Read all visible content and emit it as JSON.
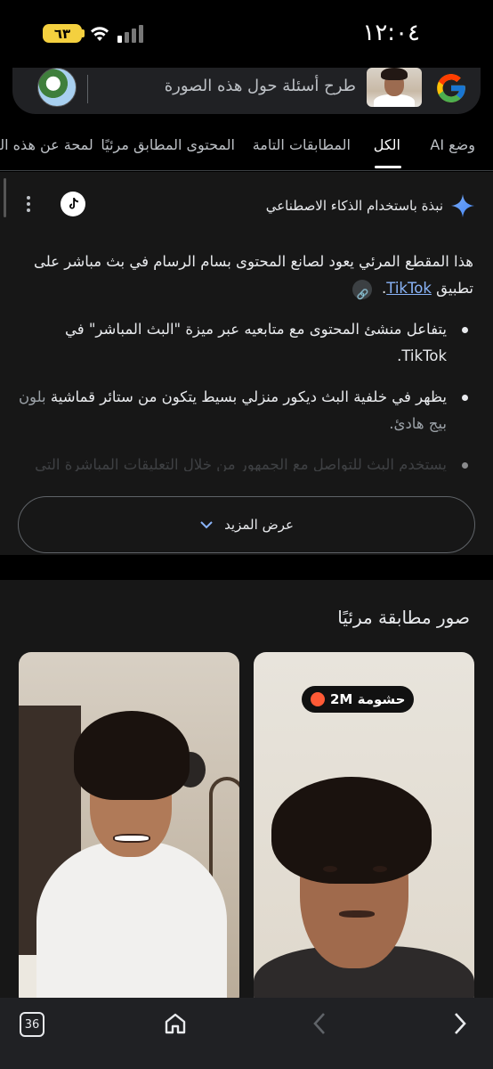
{
  "status_bar": {
    "time": "١٢:٠٤",
    "battery": "٦٣"
  },
  "search": {
    "placeholder": "طرح أسئلة حول هذه الصورة"
  },
  "tabs": [
    {
      "label": "وضع AI"
    },
    {
      "label": "الكل"
    },
    {
      "label": "المطابقات التامة"
    },
    {
      "label": "المحتوى المطابق مرئيًا"
    },
    {
      "label": "لمحة عن هذه الصورة"
    }
  ],
  "ai_overview": {
    "title": "نبذة باستخدام الذكاء الاصطناعي",
    "intro": "هذا المقطع المرئي يعود لصانع المحتوى بسام الرسام في بث مباشر على تطبيق",
    "intro_link": "TikTok",
    "intro_end": ".",
    "bullet_1": "يتفاعل منشئ المحتوى مع متابعيه عبر ميزة \"البث المباشر\" في TikTok.",
    "bullet_2_main": "يظهر في خلفية البث ديكور منزلي بسيط يتكون من ستائر قماشية",
    "bullet_2_faded": "بلون بيج هادئ.",
    "bullet_3_faded": "يستخدم البث للتواصل مع الجمهور من خلال التعليقات المباشرة التي",
    "show_more": "عرض المزيد"
  },
  "visual_matches": {
    "title": "صور مطابقة مرئيًا",
    "badge": "حشومة 2M"
  },
  "bottom_nav": {
    "tab_count": "36"
  },
  "colors": {
    "background": "#000000",
    "card": "#171717",
    "link": "#8ab4f8",
    "battery": "#f4d03f"
  }
}
